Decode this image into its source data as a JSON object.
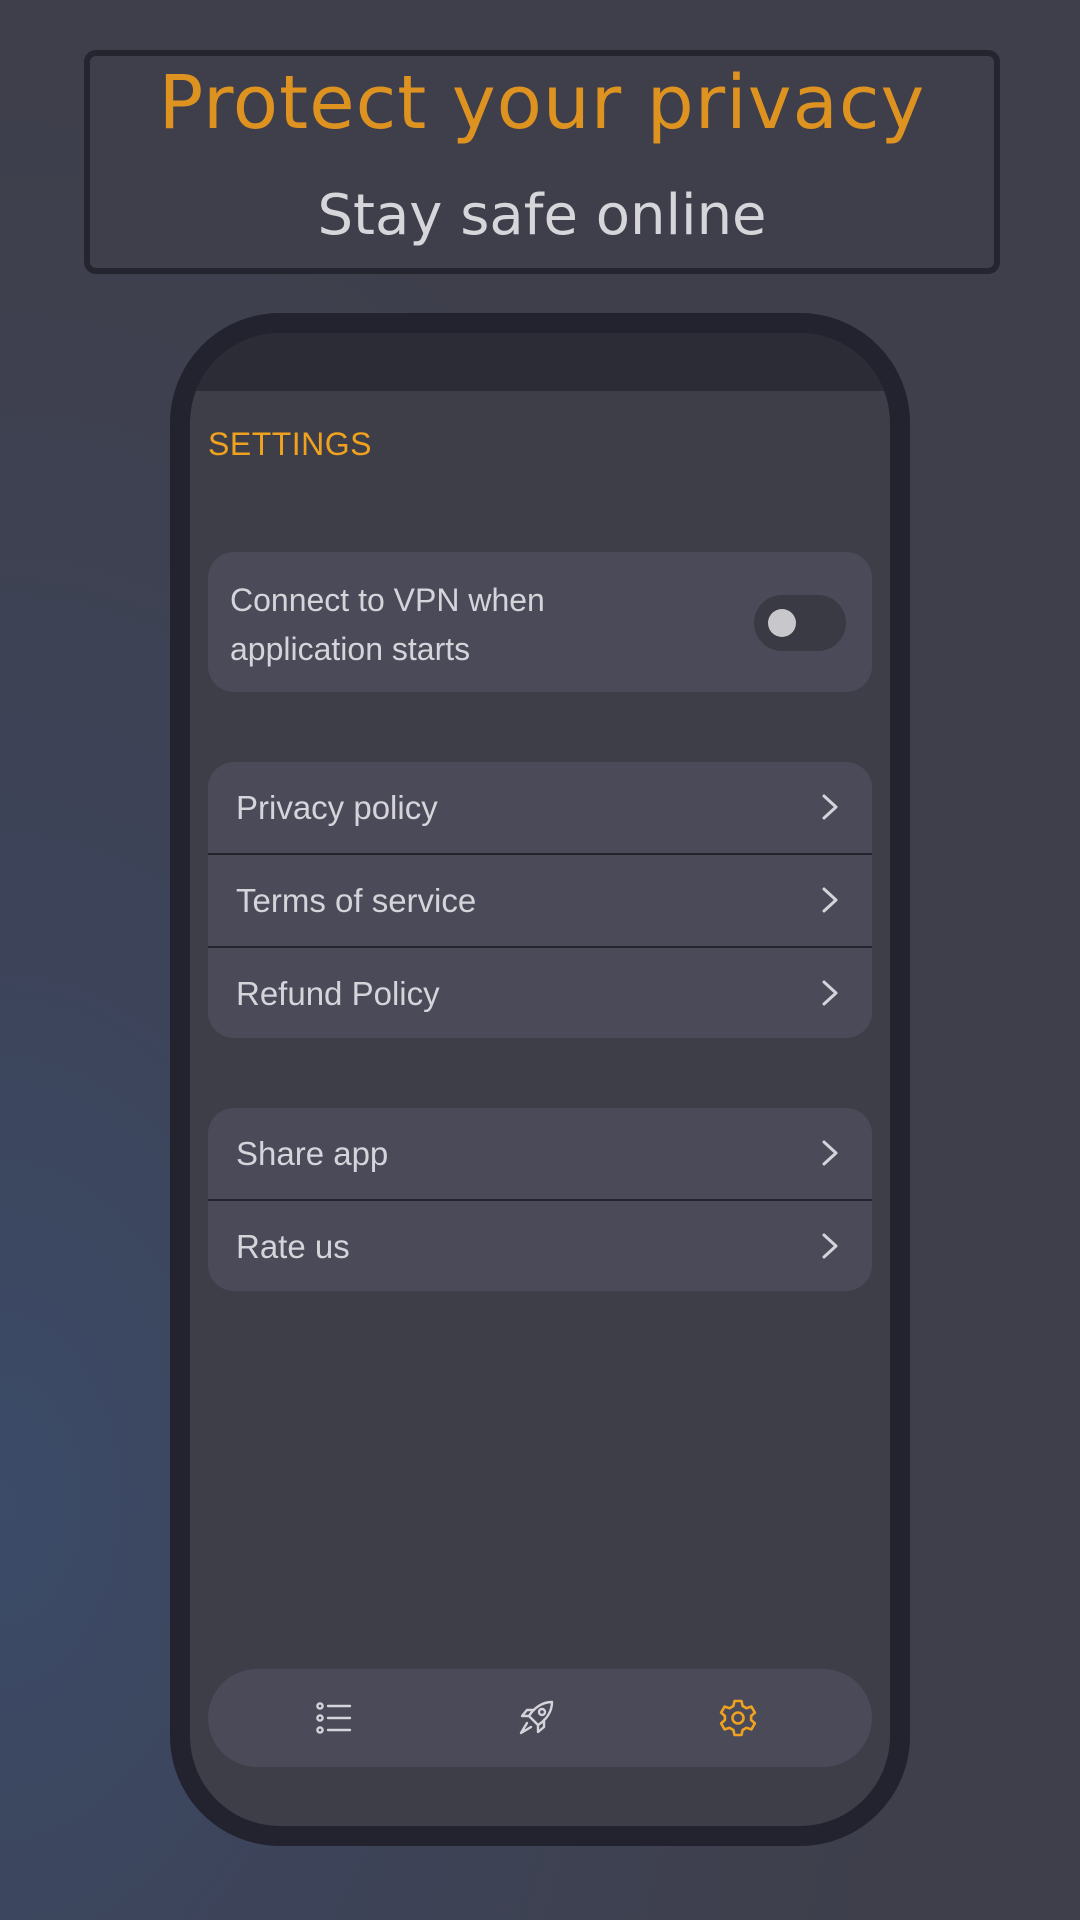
{
  "promo": {
    "title": "Protect your privacy",
    "subtitle": "Stay safe online"
  },
  "screen": {
    "title": "SETTINGS",
    "auto_connect": {
      "label": "Connect to VPN when application starts",
      "enabled": false
    },
    "policy_items": [
      {
        "label": "Privacy policy",
        "icon": "chevron-right-icon"
      },
      {
        "label": "Terms of service",
        "icon": "chevron-right-icon"
      },
      {
        "label": "Refund Policy",
        "icon": "chevron-right-icon"
      }
    ],
    "misc_items": [
      {
        "label": "Share app",
        "icon": "chevron-right-icon"
      },
      {
        "label": "Rate us",
        "icon": "chevron-right-icon"
      }
    ],
    "bottom_nav": [
      {
        "icon": "list-icon",
        "active": false
      },
      {
        "icon": "rocket-icon",
        "active": false
      },
      {
        "icon": "gear-icon",
        "active": true
      }
    ]
  },
  "colors": {
    "accent": "#f0a21f",
    "promo_title": "#de9220",
    "card": "#4b4a58",
    "screen_bg": "#3e3e49",
    "text": "#d4d4da"
  }
}
